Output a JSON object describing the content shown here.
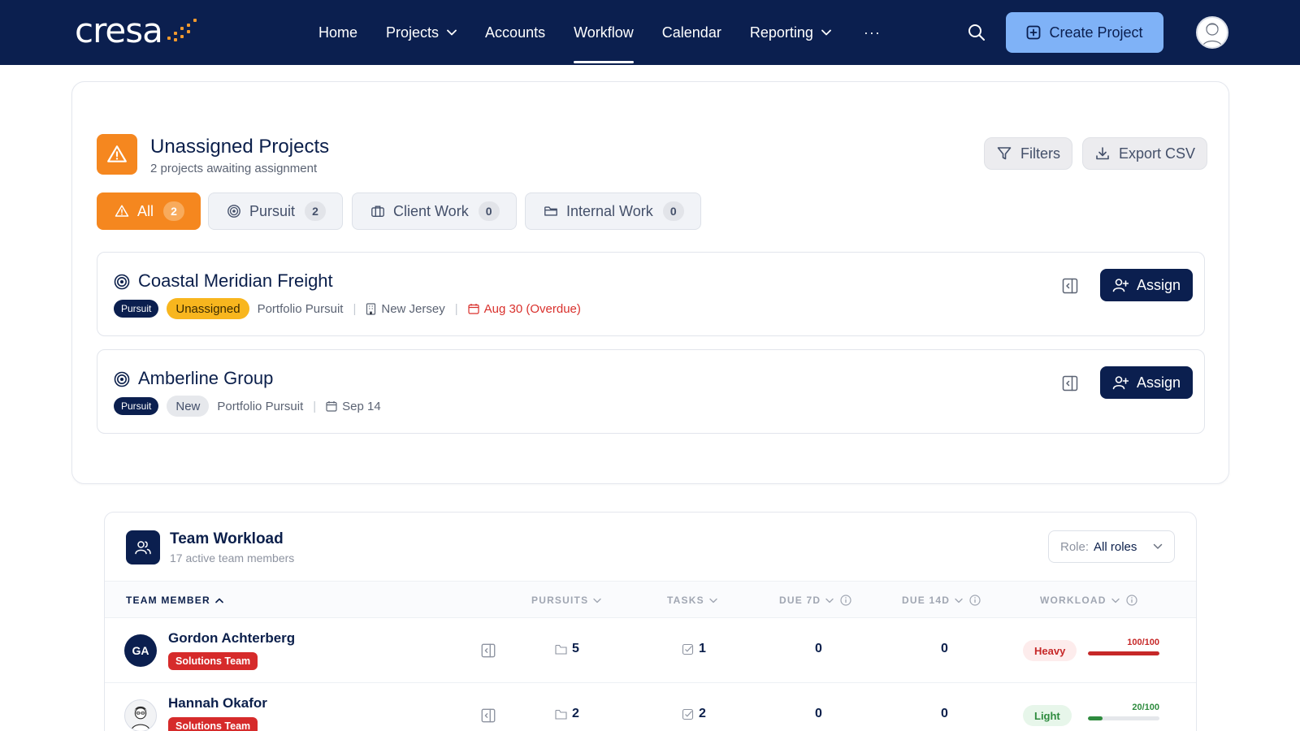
{
  "nav": {
    "logo": "cresa",
    "items": [
      {
        "label": "Home",
        "has_dropdown": false,
        "active": false
      },
      {
        "label": "Projects",
        "has_dropdown": true,
        "active": false
      },
      {
        "label": "Accounts",
        "has_dropdown": false,
        "active": false
      },
      {
        "label": "Workflow",
        "has_dropdown": false,
        "active": true
      },
      {
        "label": "Calendar",
        "has_dropdown": false,
        "active": false
      },
      {
        "label": "Reporting",
        "has_dropdown": true,
        "active": false
      }
    ],
    "more": "···",
    "create_label": "Create Project"
  },
  "unassigned": {
    "title": "Unassigned Projects",
    "subtitle": "2 projects awaiting assignment",
    "filters_label": "Filters",
    "export_label": "Export CSV",
    "tabs": [
      {
        "label": "All",
        "count": "2",
        "icon": "warning-icon",
        "active": true
      },
      {
        "label": "Pursuit",
        "count": "2",
        "icon": "target-icon",
        "active": false
      },
      {
        "label": "Client Work",
        "count": "0",
        "icon": "briefcase-icon",
        "active": false
      },
      {
        "label": "Internal Work",
        "count": "0",
        "icon": "folder-icon",
        "active": false
      }
    ],
    "projects": [
      {
        "name": "Coastal Meridian Freight",
        "type_tag": "Pursuit",
        "status": "Unassigned",
        "category": "Portfolio Pursuit",
        "location": "New Jersey",
        "due": "Aug 30 (Overdue)",
        "overdue": true,
        "assign_label": "Assign"
      },
      {
        "name": "Amberline Group",
        "type_tag": "Pursuit",
        "status": "New",
        "category": "Portfolio Pursuit",
        "location": "",
        "due": "Sep 14",
        "overdue": false,
        "assign_label": "Assign"
      }
    ]
  },
  "workload": {
    "title": "Team Workload",
    "subtitle": "17 active team members",
    "role_label": "Role:",
    "role_value": "All roles",
    "columns": {
      "member": "TEAM MEMBER",
      "pursuits": "PURSUITS",
      "tasks": "TASKS",
      "due7": "DUE 7D",
      "due14": "DUE 14D",
      "workload": "WORKLOAD"
    },
    "rows": [
      {
        "initials": "GA",
        "name": "Gordon Achterberg",
        "team": "Solutions Team",
        "pursuits": "5",
        "tasks": "1",
        "due7": "0",
        "due14": "0",
        "level": "Heavy",
        "score": "100/100",
        "pct": 100,
        "color": "#c62828"
      },
      {
        "initials": "",
        "name": "Hannah Okafor",
        "team": "Solutions Team",
        "pursuits": "2",
        "tasks": "2",
        "due7": "0",
        "due14": "0",
        "level": "Light",
        "score": "20/100",
        "pct": 20,
        "color": "#2e8b3e"
      }
    ]
  }
}
